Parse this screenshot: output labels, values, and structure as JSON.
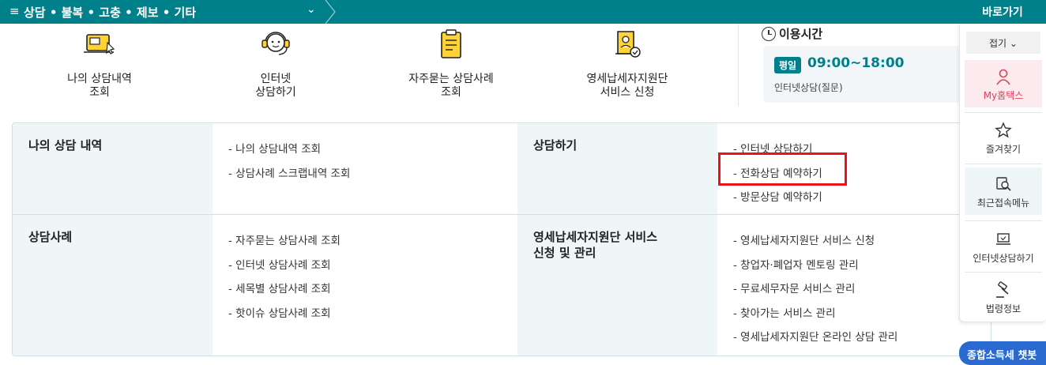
{
  "topbar": {
    "menu_label": "상담 • 불복 • 고충 • 제보 • 기타",
    "hamburger": "≡",
    "chevron": "⌄"
  },
  "quick_menu": {
    "title": "바로가기",
    "fold_label": "접기 ⌄",
    "items": [
      {
        "label": "My홈택스",
        "icon": "person-icon"
      },
      {
        "label": "즐겨찾기",
        "icon": "star-icon"
      },
      {
        "label": "최근접속메뉴",
        "icon": "recent-search-icon"
      },
      {
        "label": "인터넷상담하기",
        "icon": "laptop-icon"
      },
      {
        "label": "법령정보",
        "icon": "gavel-icon"
      }
    ]
  },
  "services": [
    {
      "label": "나의 상담내역\n조회",
      "icon": "consult-history-icon"
    },
    {
      "label": "인터넷\n상담하기",
      "icon": "headset-icon"
    },
    {
      "label": "자주묻는 상담사례\n조회",
      "icon": "clipboard-icon"
    },
    {
      "label": "영세납세자지원단\n서비스 신청",
      "icon": "certificate-icon"
    }
  ],
  "hours": {
    "title": "이용시간",
    "badge": "평일",
    "time": "09:00~18:00",
    "sub": "인터넷상담(질문)"
  },
  "sitemap": {
    "my_history": {
      "title": "나의 상담 내역",
      "links": [
        "- 나의 상담내역 조회",
        "- 상담사례 스크랩내역 조회"
      ]
    },
    "consult": {
      "title": "상담하기",
      "links": [
        "- 인터넷 상담하기",
        "- 전화상담 예약하기",
        "- 방문상담 예약하기"
      ]
    },
    "cases": {
      "title": "상담사례",
      "links": [
        "- 자주묻는 상담사례 조회",
        "- 인터넷 상담사례 조회",
        "- 세목별 상담사례 조회",
        "- 핫이슈 상담사례 조회"
      ]
    },
    "small_taxpayer": {
      "title": "영세납세자지원단 서비스\n신청 및 관리",
      "links": [
        "- 영세납세자지원단 서비스 신청",
        "- 창업자·폐업자 멘토링 관리",
        "- 무료세무자문 서비스 관리",
        "- 찾아가는 서비스 관리",
        "- 영세납세자지원단 온라인 상담 관리"
      ]
    }
  },
  "chatbot": {
    "label": "종합소득세 챗봇"
  },
  "colors": {
    "brand": "#00808a",
    "highlight": "#e8141c",
    "active": "#e0405a"
  }
}
